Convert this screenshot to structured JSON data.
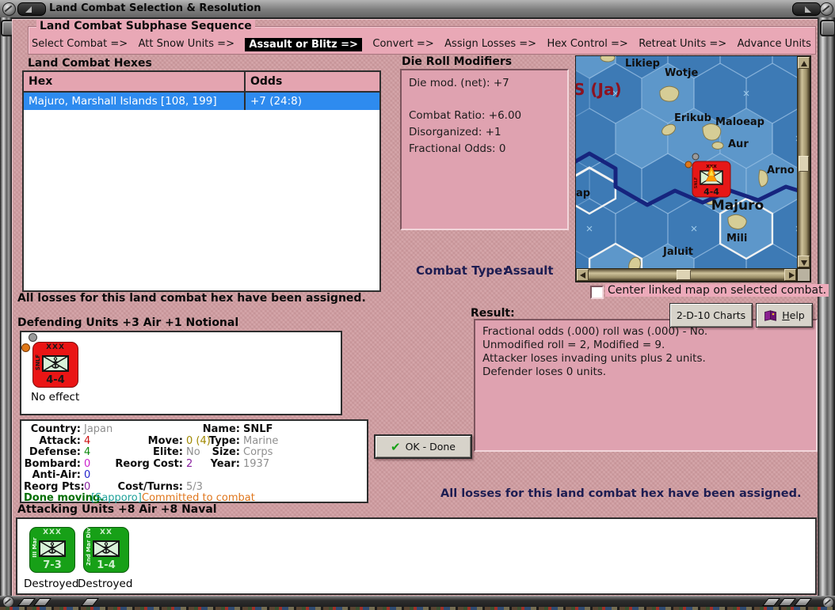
{
  "window": {
    "title": "Land Combat Selection & Resolution"
  },
  "sequence": {
    "title": "Land Combat Subphase Sequence",
    "active_index": 2,
    "steps": [
      "Select Combat =>",
      "Att Snow Units =>",
      "Assault or Blitz =>",
      "Convert =>",
      "Assign Losses =>",
      "Hex Control =>",
      "Retreat Units =>",
      "Advance Units"
    ]
  },
  "hex_table": {
    "title": "Land Combat Hexes",
    "col_hex": "Hex",
    "col_odds": "Odds",
    "row": {
      "hex": "Majuro, Marshall Islands [108, 199]",
      "odds": "+7 (24:8)"
    }
  },
  "die_modifiers": {
    "title": "Die Roll Modifiers",
    "net": "Die mod. (net): +7",
    "ratio": "Combat Ratio: +6.00",
    "disorganized": "Disorganized: +1",
    "fractional": "Fractional Odds: 0"
  },
  "map": {
    "region": "S (Ja)",
    "partial_label": "ap",
    "islands": {
      "likiep": "Likiep",
      "wotje": "Wotje",
      "erikub": "Erikub",
      "maloeap": "Maloeap",
      "aur": "Aur",
      "arno": "Arno",
      "majuro": "Majuro",
      "mili": "Mili",
      "jaluit": "Jaluit"
    },
    "counter": {
      "size": "xxx",
      "side": "SNLF",
      "strength": "4-4"
    }
  },
  "combat_type": {
    "label": "Combat Type:",
    "value": "Assault"
  },
  "checkbox": {
    "label": "Center linked map on selected combat.",
    "checked": false
  },
  "messages": {
    "top_assigned": "All losses for this land combat hex have been assigned.",
    "bottom_assigned": "All losses for this land combat hex have been assigned."
  },
  "defending": {
    "title": "Defending Units +3 Air +1 Notional",
    "units": [
      {
        "size": "XXX",
        "side": "SNLF",
        "strength": "4-4",
        "status": "No effect"
      }
    ]
  },
  "attacking": {
    "title": "Attacking Units +8 Air +8 Naval",
    "units": [
      {
        "size": "XXX",
        "side": "III Mar",
        "strength": "7-3",
        "status": "Destroyed"
      },
      {
        "size": "XX",
        "side": "2nd Mar Div",
        "strength": "1-4",
        "status": "Destroyed"
      }
    ]
  },
  "unit_info": {
    "country_label": "Country:",
    "country": "Japan",
    "attack_label": "Attack:",
    "attack": "4",
    "defense_label": "Defense:",
    "defense": "4",
    "bombard_label": "Bombard:",
    "bombard": "0",
    "antiair_label": "Anti-Air:",
    "antiair": "0",
    "reorgpts_label": "Reorg Pts:",
    "reorgpts": "0",
    "name_label": "Name:",
    "name": "SNLF",
    "move_label": "Move:",
    "move": "0 (4)",
    "type_label": "Type:",
    "type": "Marine",
    "elite_label": "Elite:",
    "elite": "No",
    "size_label": "Size:",
    "size": "Corps",
    "reorgcost_label": "Reorg Cost:",
    "reorgcost": "2",
    "year_label": "Year:",
    "year": "1937",
    "costturns_label": "Cost/Turns:",
    "costturns": "5/3",
    "status_done": "Done moving.",
    "status_city": "[Sapporo]",
    "status_committed": "Committed to combat"
  },
  "result": {
    "label": "Result:",
    "lines": [
      "Fractional odds (.000) roll was (.000)  - No.",
      "Unmodified roll = 2, Modified = 9.",
      "Attacker loses invading units plus 2 units.",
      "Defender loses 0 units."
    ]
  },
  "buttons": {
    "charts": "2-D-10 Charts",
    "help_initial": "H",
    "help_rest": "elp",
    "ok": "OK - Done"
  },
  "colors": {
    "background_pink": "#cf9da1",
    "panel_pink": "#dfa2b0",
    "groupbox_pink": "#e9a8b6",
    "selected_row_blue": "#2e8bef",
    "ocean_blue": "#3d7ab5",
    "hex_light_blue": "#5d97ca",
    "defender_counter_red": "#ea1515",
    "attacker_counter_green": "#17a017",
    "attack_value": "#cc1111",
    "defense_value": "#0c8a0c",
    "bombard_value": "#cc22cc",
    "antiair_value": "#2222cc",
    "reorg_value": "#8a22a0",
    "move_value": "#a08800",
    "status_done_green": "#006e00",
    "status_city_teal": "#1fa29a",
    "status_committed_orange": "#e0761c",
    "map_region_label": "#8c1220",
    "navy_sea_line": "#16247e"
  }
}
